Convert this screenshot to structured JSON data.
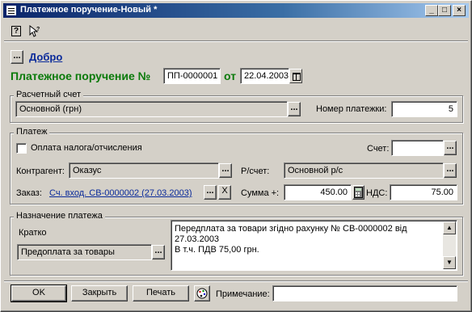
{
  "window": {
    "title": "Платежное поручение-Новый *",
    "controls": {
      "minimize": "_",
      "maximize": "□",
      "close": "×"
    }
  },
  "toolbar": {
    "help_icon": "?",
    "whats_this_icon": "?"
  },
  "header": {
    "link_button_label": "...",
    "link_text": "Добро",
    "doc_label": "Платежное поручение №",
    "doc_number": "ПП-0000001",
    "date_label": "от",
    "date_value": "22.04.2003"
  },
  "account_group": {
    "title": "Расчетный счет",
    "account_value": "Основной (грн)",
    "payment_no_label": "Номер платежки:",
    "payment_no_value": "5"
  },
  "payment_group": {
    "title": "Платеж",
    "tax_checkbox_label": "Оплата налога/отчисления",
    "tax_checked": false,
    "account_label": "Счет:",
    "account_value": "",
    "counterparty_label": "Контрагент:",
    "counterparty_value": "Оказус",
    "rs_label": "Р/счет:",
    "rs_value": "Основной р/с",
    "order_label": "Заказ:",
    "order_value": "Сч. вход. СВ-0000002 (27.03.2003)",
    "clear_label": "X",
    "sum_label": "Сумма +:",
    "sum_value": "450.00",
    "vat_label": "НДС:",
    "vat_value": "75.00"
  },
  "purpose_group": {
    "title": "Назначение платежа",
    "short_label": "Кратко",
    "short_value": "Предоплата за товары",
    "text_lines": [
      "Передплата за товари згідно рахунку № СВ-0000002 від",
      "27.03.2003",
      "В т.ч. ПДВ 75,00 грн."
    ]
  },
  "footer": {
    "ok_label": "OK",
    "close_label": "Закрыть",
    "print_label": "Печать",
    "note_label": "Примечание:",
    "note_value": ""
  },
  "colors": {
    "title_green": "#0a7a0a",
    "link_blue": "#0a2a9a",
    "titlebar": "#0a246a"
  }
}
